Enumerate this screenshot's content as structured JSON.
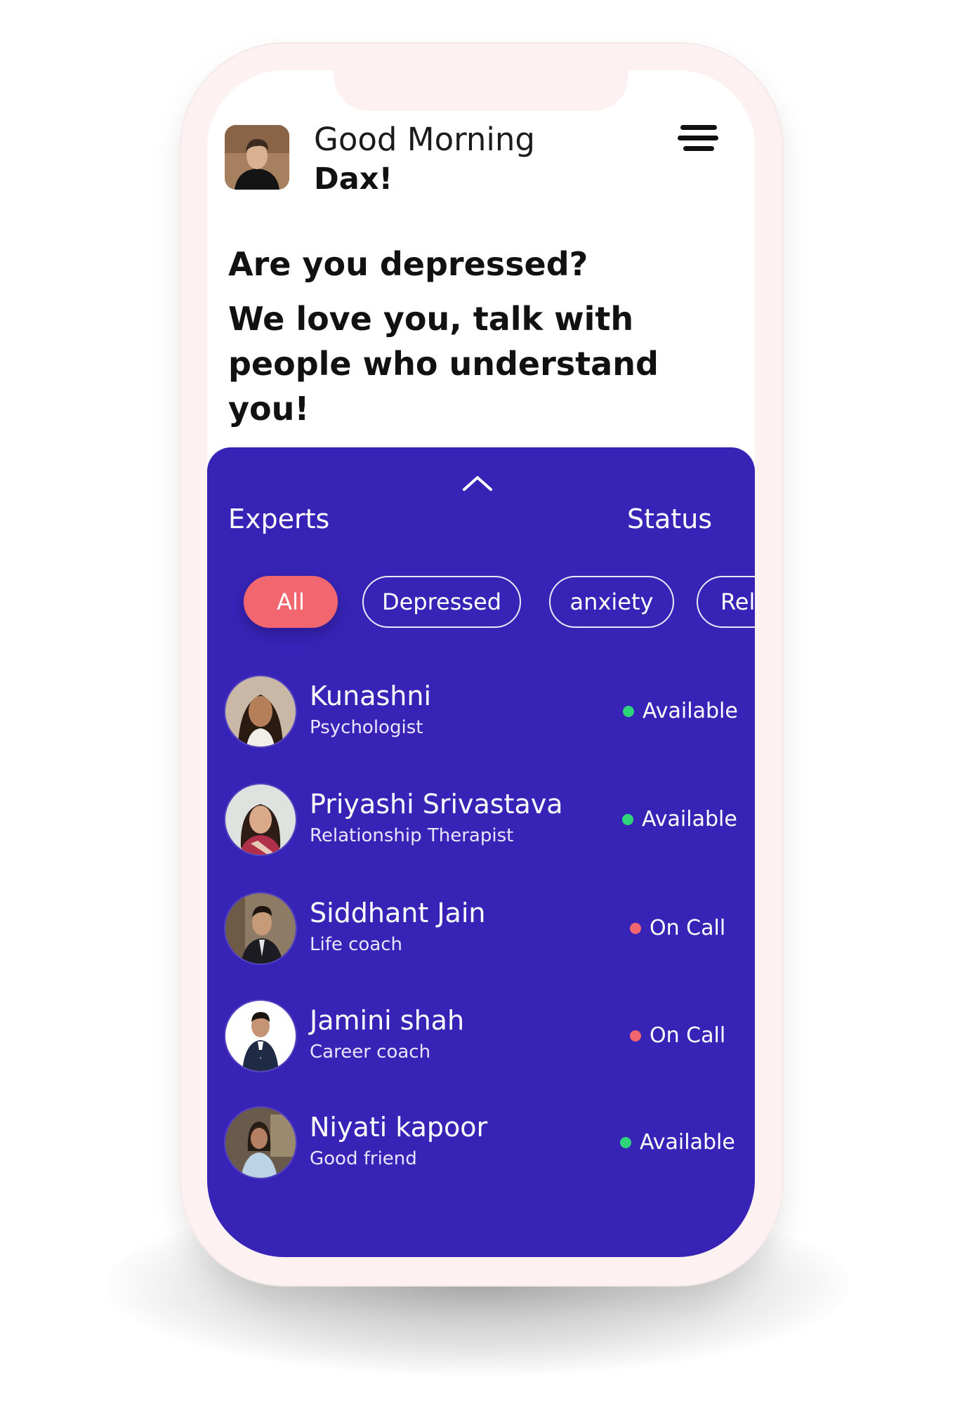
{
  "header": {
    "greeting": "Good Morning",
    "user_name": "Dax!",
    "headline_line1": "Are you depressed?",
    "headline_line2": "We love you, talk with people who understand you!"
  },
  "icons": {
    "menu": "hamburger-menu-icon",
    "collapse": "chevron-up-icon"
  },
  "panel": {
    "experts_label": "Experts",
    "status_label": "Status",
    "filters": [
      "All",
      "Depressed",
      "anxiety",
      "Rel"
    ],
    "active_filter": "All"
  },
  "experts": [
    {
      "name": "Kunashni",
      "role": "Psychologist",
      "status": "Available"
    },
    {
      "name": "Priyashi Srivastava",
      "role": "Relationship Therapist",
      "status": "Available"
    },
    {
      "name": "Siddhant Jain",
      "role": "Life coach",
      "status": "On Call"
    },
    {
      "name": "Jamini shah",
      "role": "Career coach",
      "status": "On Call"
    },
    {
      "name": "Niyati kapoor",
      "role": "Good friend",
      "status": "Available"
    }
  ],
  "colors": {
    "panel": "#3723b6",
    "accent": "#f26670",
    "available": "#2ed47a",
    "on_call": "#f26670",
    "phone_frame": "#fdf2f1"
  }
}
